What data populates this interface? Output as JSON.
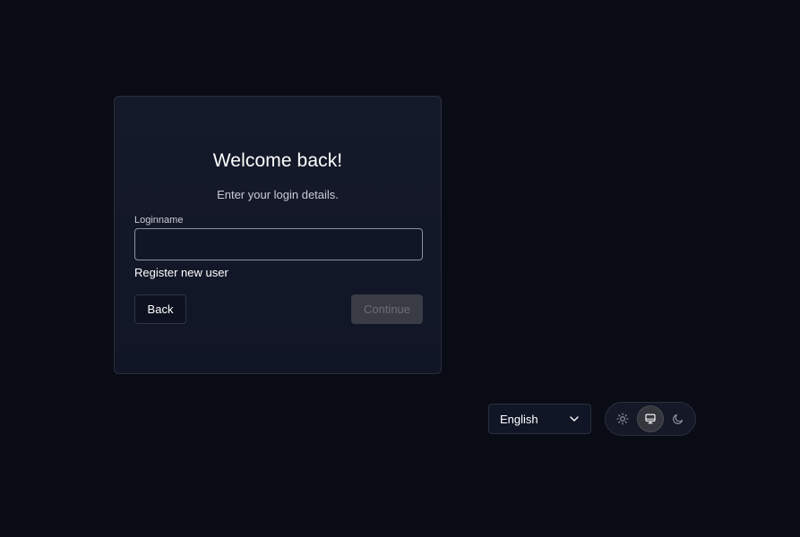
{
  "login": {
    "title": "Welcome back!",
    "subtitle": "Enter your login details.",
    "loginname_label": "Loginname",
    "loginname_value": "",
    "register_link": "Register new user",
    "back_label": "Back",
    "continue_label": "Continue"
  },
  "footer": {
    "language": "English",
    "theme_options": [
      "light",
      "system",
      "dark"
    ],
    "theme_selected": "system"
  },
  "icons": {
    "language_chevron": "chevron-down-icon",
    "theme_light": "sun-icon",
    "theme_system": "monitor-icon",
    "theme_dark": "moon-icon"
  },
  "colors": {
    "background": "#0a0c15",
    "card": "#131828",
    "border": "#2a2f3d",
    "disabled_button": "#393c45"
  }
}
